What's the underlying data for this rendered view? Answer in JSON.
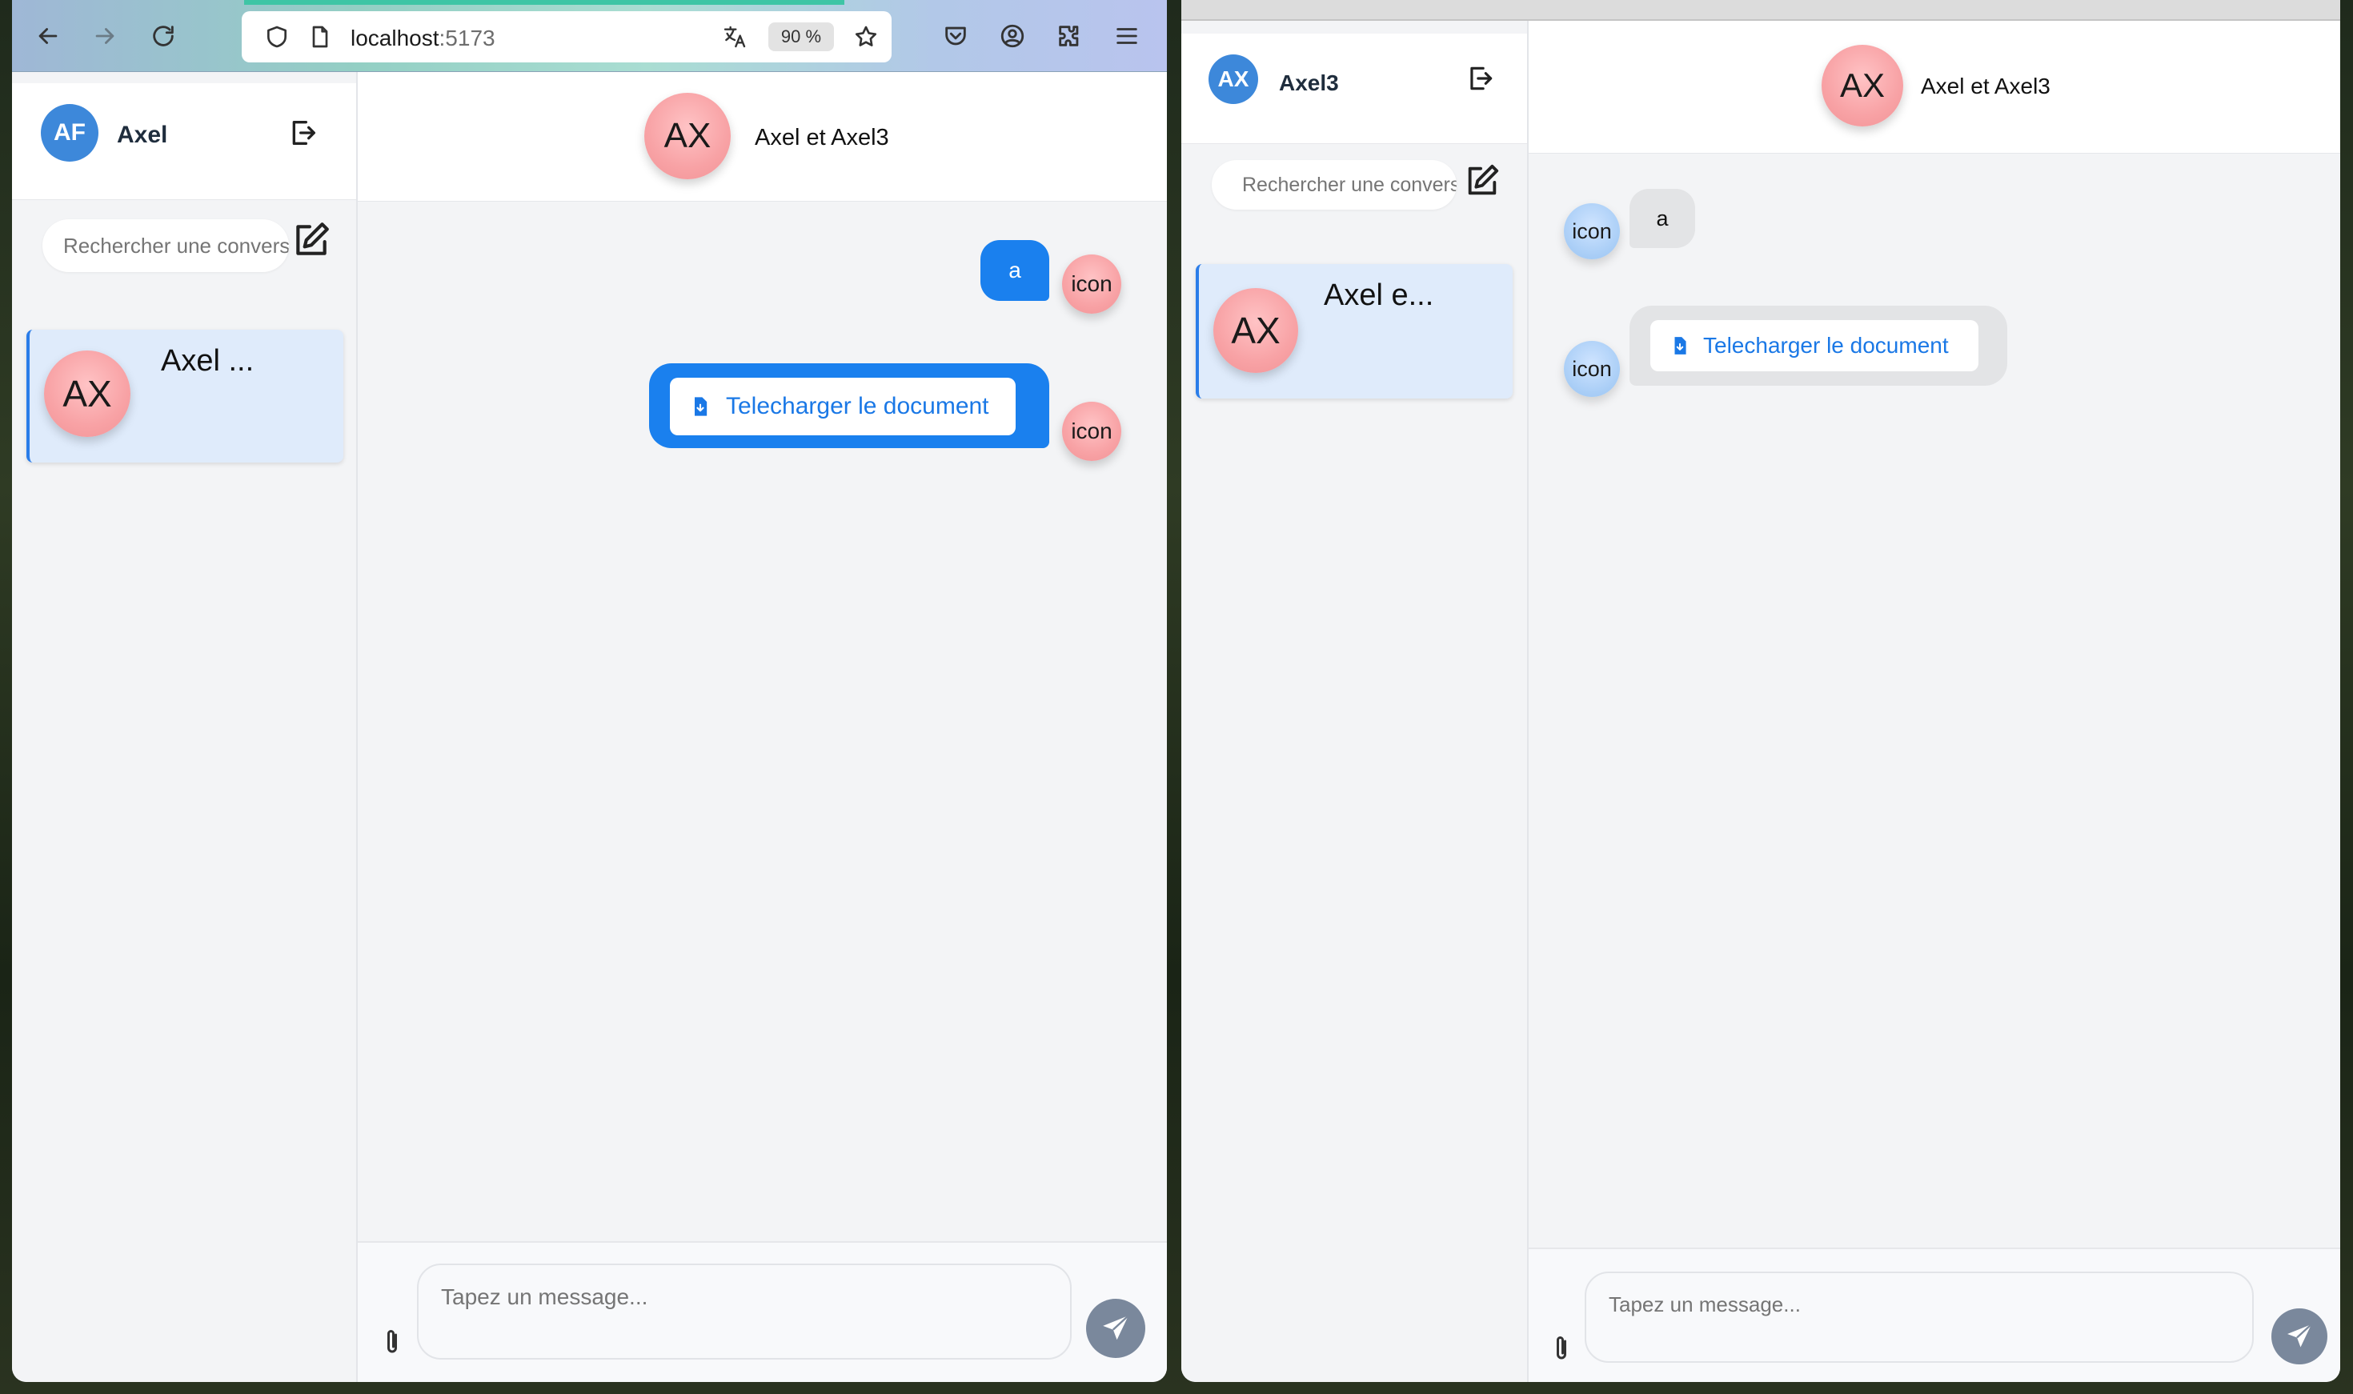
{
  "browser": {
    "url_host": "localhost",
    "url_port": ":5173",
    "zoom": "90 %",
    "icons": [
      "back-icon",
      "forward-icon",
      "reload-icon",
      "shield-icon",
      "page-icon",
      "translate-icon",
      "star-icon",
      "pocket-icon",
      "account-icon",
      "extensions-icon",
      "menu-icon"
    ]
  },
  "left_app": {
    "user_initials": "AF",
    "user_name": "Axel",
    "search_placeholder": "Rechercher une conversation",
    "conversation": {
      "initials": "AX",
      "name": "Axel ..."
    },
    "chat": {
      "header_initials": "AX",
      "title": "Axel et Axel3",
      "messages": [
        {
          "type": "text",
          "text": "a",
          "avatar": "icon"
        },
        {
          "type": "document",
          "button_label": "Telecharger le document",
          "avatar": "icon"
        }
      ]
    },
    "composer_placeholder": "Tapez un message..."
  },
  "right_app": {
    "user_initials": "AX",
    "user_name": "Axel3",
    "search_placeholder": "Rechercher une conversation",
    "conversation": {
      "initials": "AX",
      "name": "Axel e..."
    },
    "chat": {
      "header_initials": "AX",
      "title": "Axel et Axel3",
      "messages": [
        {
          "type": "text",
          "text": "a",
          "avatar": "icon"
        },
        {
          "type": "document",
          "button_label": "Telecharger le document",
          "avatar": "icon"
        }
      ]
    },
    "composer_placeholder": "Tapez un message..."
  },
  "colors": {
    "accent_blue": "#1a80ee",
    "avatar_pink": "#f8a2a5",
    "avatar_blue": "#3d88da",
    "selected_conv": "#dfebfb"
  }
}
